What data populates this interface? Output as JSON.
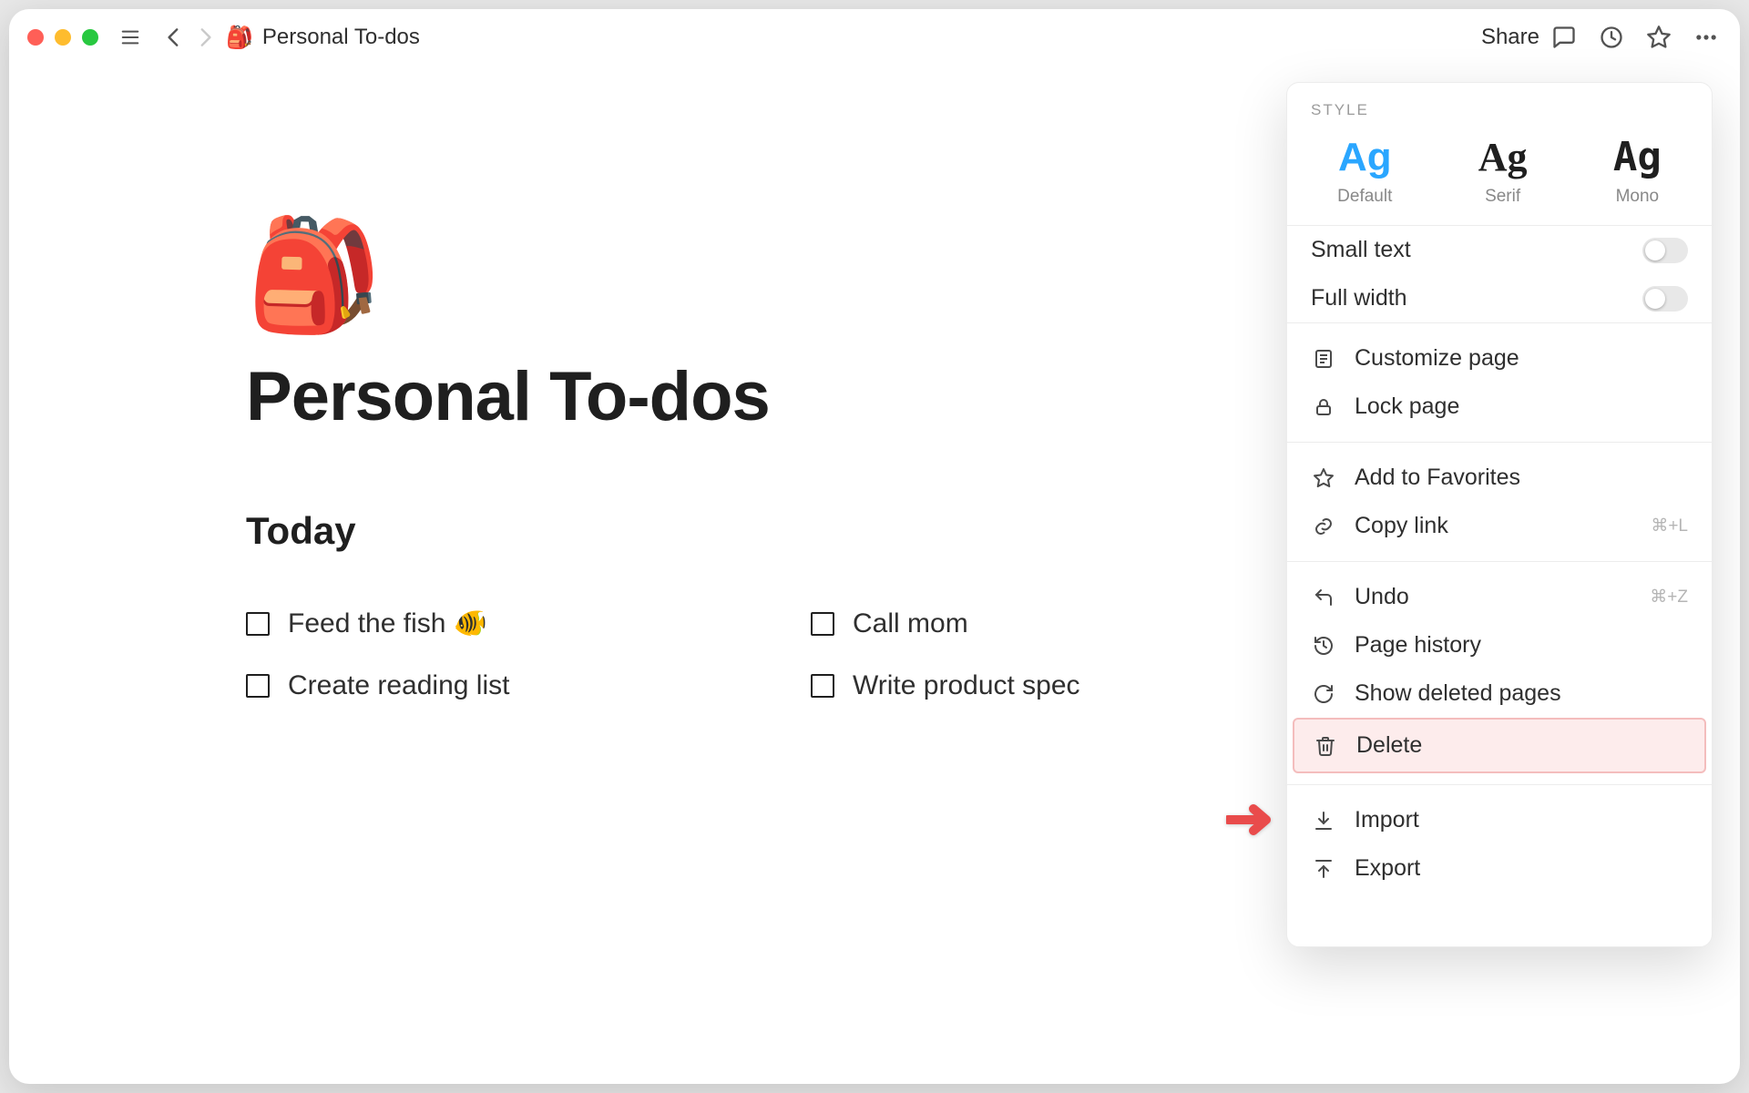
{
  "breadcrumb": {
    "icon": "🎒",
    "title": "Personal To-dos"
  },
  "share_label": "Share",
  "page": {
    "icon": "🎒",
    "title": "Personal To-dos",
    "section": "Today",
    "todos": [
      "Feed the fish 🐠",
      "Call mom",
      "Create reading list",
      "Write product spec"
    ]
  },
  "panel": {
    "style_label": "STYLE",
    "fonts": [
      {
        "sample": "Ag",
        "label": "Default",
        "selected": true
      },
      {
        "sample": "Ag",
        "label": "Serif",
        "selected": false
      },
      {
        "sample": "Ag",
        "label": "Mono",
        "selected": false
      }
    ],
    "toggles": [
      {
        "label": "Small text",
        "on": false
      },
      {
        "label": "Full width",
        "on": false
      }
    ],
    "group_page": [
      {
        "icon": "customize",
        "label": "Customize page"
      },
      {
        "icon": "lock",
        "label": "Lock page"
      }
    ],
    "group_share": [
      {
        "icon": "star",
        "label": "Add to Favorites"
      },
      {
        "icon": "link",
        "label": "Copy link",
        "shortcut": "⌘+L"
      }
    ],
    "group_history": [
      {
        "icon": "undo",
        "label": "Undo",
        "shortcut": "⌘+Z"
      },
      {
        "icon": "history",
        "label": "Page history"
      },
      {
        "icon": "restore",
        "label": "Show deleted pages"
      },
      {
        "icon": "trash",
        "label": "Delete",
        "highlight": true
      }
    ],
    "group_io": [
      {
        "icon": "import",
        "label": "Import"
      },
      {
        "icon": "export",
        "label": "Export"
      }
    ]
  }
}
